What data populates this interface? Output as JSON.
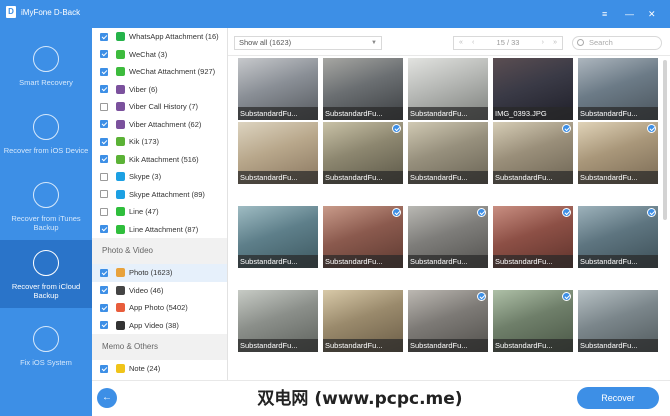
{
  "app": {
    "title": "iMyFone D-Back",
    "logo_letter": "D"
  },
  "window_controls": {
    "menu": "≡",
    "minimize": "—",
    "close": "✕"
  },
  "sidebar": {
    "items": [
      {
        "label": "Smart Recovery",
        "icon": "smart-recovery-icon",
        "active": false
      },
      {
        "label": "Recover from iOS Device",
        "icon": "phone-icon",
        "active": false
      },
      {
        "label": "Recover from iTunes Backup",
        "icon": "music-note-icon",
        "active": false
      },
      {
        "label": "Recover from iCloud Backup",
        "icon": "cloud-download-icon",
        "active": true
      },
      {
        "label": "Fix iOS System",
        "icon": "wrench-icon",
        "active": false
      }
    ]
  },
  "categories": {
    "rows_a": [
      {
        "label": "WhatsApp Attachment (16)",
        "checked": true,
        "icon_color": "#25b34a"
      },
      {
        "label": "WeChat (3)",
        "checked": true,
        "icon_color": "#3dbb3d"
      },
      {
        "label": "WeChat Attachment (927)",
        "checked": true,
        "icon_color": "#3dbb3d"
      },
      {
        "label": "Viber (6)",
        "checked": true,
        "icon_color": "#7b519d"
      },
      {
        "label": "Viber Call History (7)",
        "checked": false,
        "icon_color": "#7b519d"
      },
      {
        "label": "Viber Attachment (62)",
        "checked": true,
        "icon_color": "#7b519d"
      },
      {
        "label": "Kik (173)",
        "checked": true,
        "icon_color": "#5bb236"
      },
      {
        "label": "Kik Attachment (516)",
        "checked": true,
        "icon_color": "#5bb236"
      },
      {
        "label": "Skype (3)",
        "checked": false,
        "icon_color": "#1ca0e3"
      },
      {
        "label": "Skype Attachment (89)",
        "checked": false,
        "icon_color": "#1ca0e3"
      },
      {
        "label": "Line (47)",
        "checked": false,
        "icon_color": "#2fbe3c"
      },
      {
        "label": "Line Attachment (87)",
        "checked": true,
        "icon_color": "#2fbe3c"
      }
    ],
    "section_photo": "Photo & Video",
    "rows_b": [
      {
        "label": "Photo (1623)",
        "checked": true,
        "icon_color": "#e8a23c",
        "selected": true
      },
      {
        "label": "Video (46)",
        "checked": true,
        "icon_color": "#444444"
      },
      {
        "label": "App Photo (5402)",
        "checked": true,
        "icon_color": "#e85d3c"
      },
      {
        "label": "App Video (38)",
        "checked": true,
        "icon_color": "#333333"
      }
    ],
    "section_memo": "Memo & Others",
    "rows_c": [
      {
        "label": "Note (24)",
        "checked": true,
        "icon_color": "#f0c419"
      }
    ]
  },
  "toolbar": {
    "filter_value": "Show all (1623)",
    "page_first": "«",
    "page_prev": "‹",
    "page_text": "15 / 33",
    "page_next": "›",
    "page_last": "»",
    "search_placeholder": "Search"
  },
  "thumbnails": [
    {
      "caption": "SubstandardFu...",
      "checked": false,
      "colors": [
        "#8a8f96",
        "#c7c9cc",
        "#55595e"
      ]
    },
    {
      "caption": "SubstandardFu...",
      "checked": false,
      "colors": [
        "#6b6f72",
        "#a7a7a3",
        "#3c3f42"
      ]
    },
    {
      "caption": "SubstandardFu...",
      "checked": false,
      "colors": [
        "#b5b7b4",
        "#e2e3e0",
        "#7d807c"
      ]
    },
    {
      "caption": "IMG_0393.JPG",
      "checked": false,
      "colors": [
        "#3a3a46",
        "#5b4e52",
        "#1f1f29"
      ]
    },
    {
      "caption": "SubstandardFu...",
      "checked": false,
      "colors": [
        "#6c7b87",
        "#adb6be",
        "#4a545c"
      ]
    },
    {
      "caption": "SubstandardFu...",
      "checked": false,
      "colors": [
        "#b8a78b",
        "#ddd4c0",
        "#8a7760"
      ]
    },
    {
      "caption": "SubstandardFu...",
      "checked": true,
      "colors": [
        "#8d8770",
        "#c9c2a7",
        "#5c5848"
      ]
    },
    {
      "caption": "SubstandardFu...",
      "checked": false,
      "colors": [
        "#97907d",
        "#d0c9b3",
        "#6a6455"
      ]
    },
    {
      "caption": "SubstandardFu...",
      "checked": true,
      "colors": [
        "#9a8f7a",
        "#d6cdb6",
        "#6e6554"
      ]
    },
    {
      "caption": "SubstandardFu...",
      "checked": true,
      "colors": [
        "#a9977a",
        "#e0d3b8",
        "#7b6b55"
      ]
    },
    {
      "caption": "SubstandardFu...",
      "checked": false,
      "colors": [
        "#5e7f8a",
        "#9fbcc3",
        "#3d5860"
      ]
    },
    {
      "caption": "SubstandardFu...",
      "checked": true,
      "colors": [
        "#8b5a4e",
        "#c99b8a",
        "#5e3a31"
      ]
    },
    {
      "caption": "SubstandardFu...",
      "checked": true,
      "colors": [
        "#7e7d7a",
        "#b9b8b3",
        "#53524f"
      ]
    },
    {
      "caption": "SubstandardFu...",
      "checked": true,
      "colors": [
        "#8d5046",
        "#c98f82",
        "#5f332c"
      ]
    },
    {
      "caption": "SubstandardFu...",
      "checked": true,
      "colors": [
        "#5e7580",
        "#9db2bb",
        "#3d4f57"
      ]
    },
    {
      "caption": "SubstandardFu...",
      "checked": false,
      "colors": [
        "#8b8f8a",
        "#c7cbc5",
        "#5e625d"
      ]
    },
    {
      "caption": "SubstandardFu...",
      "checked": false,
      "colors": [
        "#9a8a6c",
        "#d8c9a8",
        "#6b5d47"
      ]
    },
    {
      "caption": "SubstandardFu...",
      "checked": true,
      "colors": [
        "#7d7a76",
        "#bcb8b2",
        "#52504c"
      ]
    },
    {
      "caption": "SubstandardFu...",
      "checked": true,
      "colors": [
        "#6f7f6a",
        "#aec0a7",
        "#4a5746"
      ]
    },
    {
      "caption": "SubstandardFu...",
      "checked": false,
      "colors": [
        "#7b868b",
        "#b6c0c3",
        "#525b5e"
      ]
    }
  ],
  "footer": {
    "back": "←",
    "recover_label": "Recover",
    "watermark": "双电网 (www.pcpc.me)"
  }
}
